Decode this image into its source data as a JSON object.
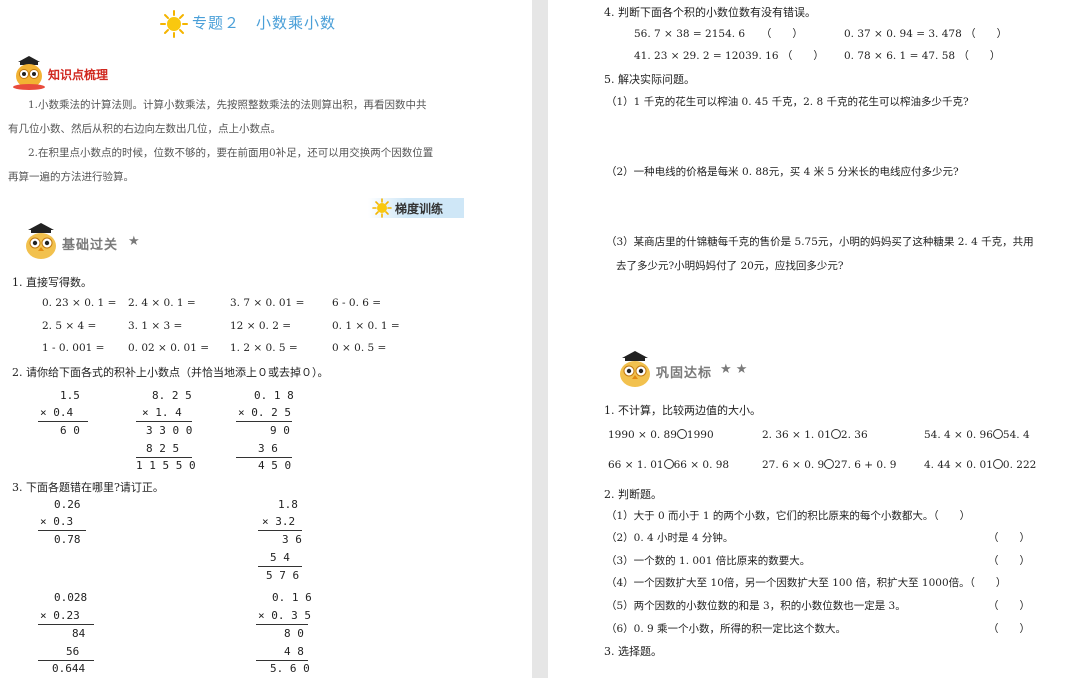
{
  "left": {
    "title": "专题２　小数乘小数",
    "knowledge_heading": "知识点梳理",
    "knowledge_p1a": "1.小数乘法的计算法则。计算小数乘法，先按照整数乘法的法则算出积，再看因数中共",
    "knowledge_p1b": "有几位小数、然后从积的右边向左数出几位，点上小数点。",
    "knowledge_p2a": "2.在积里点小数点的时候，位数不够的，要在前面用0补足，还可以用交换两个因数位置",
    "knowledge_p2b": "再算一遍的方法进行验算。",
    "gradient_label": "梯度训练",
    "basic_heading": "基础过关",
    "basic_star": "★",
    "q1_title": "1. 直接写得数。",
    "q1_items": [
      "0. 23 × 0. 1 =",
      "2. 4 × 0. 1 =",
      "3. 7 × 0. 01 =",
      "6 - 0. 6 =",
      "2. 5 × 4 =",
      "3. 1 × 3 =",
      "12 × 0. 2 =",
      "0. 1 × 0. 1 =",
      "1 - 0. 001 =",
      "0. 02 × 0. 01 =",
      "1. 2 × 0. 5 =",
      "0 × 0. 5 ="
    ],
    "q2_title": "2. 请你给下面各式的积补上小数点（并恰当地添上０或去掉０）。",
    "q2_calc": [
      {
        "r1": "1.5",
        "r2": "×  0.4",
        "r3": "6 0",
        "r4": "",
        "r5": ""
      },
      {
        "r1": "8. 2 5",
        "r2": "×   1. 4",
        "r3": "3 3 0 0",
        "r4": "8 2 5",
        "r5": "1 1 5 5 0"
      },
      {
        "r1": "0. 1 8",
        "r2": "× 0. 2 5",
        "r3": "9 0",
        "r4": "3 6",
        "r5": "4 5 0"
      }
    ],
    "q3_title": "3. 下面各题错在哪里?请订正。",
    "q3_calc": [
      {
        "r1": "0.26",
        "r2": "×  0.3",
        "r3": "0.78",
        "r4": "",
        "r5": ""
      },
      {
        "r1": "1.8",
        "r2": "× 3.2",
        "r3": "3 6",
        "r4": "5 4",
        "r5": "5 7 6"
      },
      {
        "r1": "0.028",
        "r2": "×  0.23",
        "r3": "84",
        "r4": "56",
        "r5": "0.644"
      },
      {
        "r1": "0. 1 6",
        "r2": "× 0. 3 5",
        "r3": "8 0",
        "r4": "4 8",
        "r5": "5. 6 0"
      }
    ]
  },
  "right": {
    "q4_title": "4. 判断下面各个积的小数位数有没有错误。",
    "q4_items": [
      "56. 7 × 38 = 2154. 6　　（　　）",
      "0. 37 × 0. 94 = 3. 478 （　　）",
      "41. 23 × 29. 2 = 12039. 16 （　　）",
      "0. 78 × 6. 1 = 47. 58 （　　）"
    ],
    "q5_title": "5. 解决实际问题。",
    "q5_1": "（1）1 千克的花生可以榨油 0. 45 千克，2. 8 千克的花生可以榨油多少千克?",
    "q5_2": "（2）一种电线的价格是每米 0. 88元，买 4 米 5 分米长的电线应付多少元?",
    "q5_3a": "（3）某商店里的什锦糖每千克的售价是 5.75元，小明的妈妈买了这种糖果 2. 4 千克，共用",
    "q5_3b": "去了多少元?小明妈妈付了 20元，应找回多少元?",
    "consolidate_heading": "巩固达标",
    "consolidate_stars": "★ ★",
    "r1_title": "1. 不计算，比较两边值的大小。",
    "r1_items": [
      {
        "l": "1990 × 0. 89",
        "r": "1990"
      },
      {
        "l": "2. 36 × 1. 01",
        "r": "2. 36"
      },
      {
        "l": "54. 4 × 0. 96",
        "r": "54. 4"
      },
      {
        "l": "66 × 1. 01",
        "r": "66 × 0. 98"
      },
      {
        "l": "27. 6 × 0. 9",
        "r": "27. 6 + 0. 9"
      },
      {
        "l": "4. 44 × 0. 01",
        "r": "0. 222"
      }
    ],
    "r2_title": "2. 判断题。",
    "r2_items": [
      "（1）大于 0 而小于 1 的两个小数，它们的积比原来的每个小数都大。（　　）",
      "（2）0. 4 小时是 4 分钟。",
      "（3）一个数的 1. 001 倍比原来的数要大。",
      "（4）一个因数扩大至 10倍，另一个因数扩大至 100 倍，积扩大至 1000倍。（　　）",
      "（5）两个因数的小数位数的和是 3，积的小数位数也一定是 3。",
      "（6）0. 9 乘一个小数，所得的积一定比这个数大。"
    ],
    "r2_paren": "（　　）",
    "r3_title": "3. 选择题。"
  }
}
